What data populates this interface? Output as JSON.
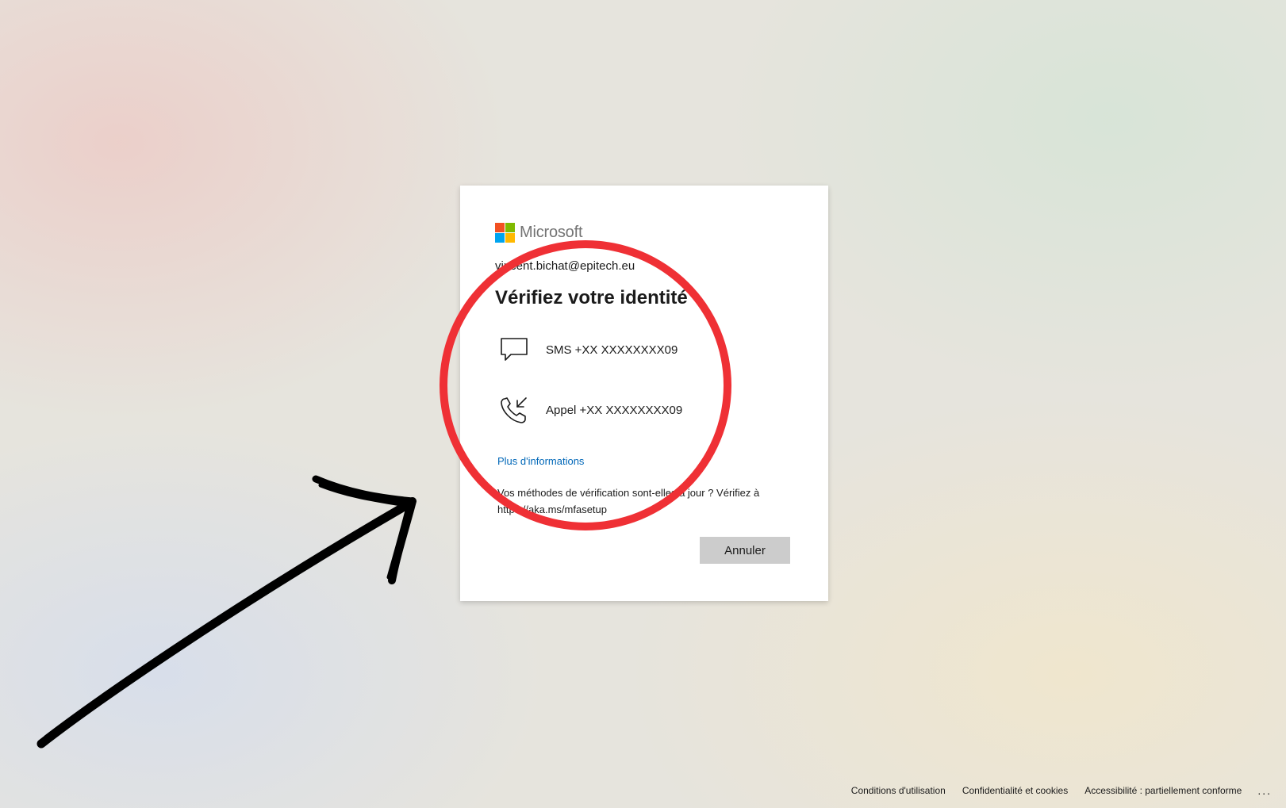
{
  "brand": {
    "name": "Microsoft",
    "logo_colors": [
      "#f25022",
      "#7fba00",
      "#00a4ef",
      "#ffb900"
    ]
  },
  "account": {
    "email": "vincent.bichat@epitech.eu"
  },
  "page_title": "Vérifiez votre identité",
  "options": [
    {
      "icon": "chat-bubble-icon",
      "label": "SMS +XX XXXXXXXX09"
    },
    {
      "icon": "phone-incoming-icon",
      "label": "Appel +XX XXXXXXXX09"
    }
  ],
  "more_info_link": "Plus d'informations",
  "note": "Vos méthodes de vérification sont-elles à jour ? Vérifiez à https://aka.ms/mfasetup",
  "cancel_label": "Annuler",
  "footer": {
    "terms": "Conditions d'utilisation",
    "privacy": "Confidentialité et cookies",
    "accessibility": "Accessibilité : partiellement conforme",
    "more": "..."
  },
  "colors": {
    "link": "#0067b8",
    "annotation_circle": "#ef3035",
    "annotation_arrow": "#000000",
    "cancel_button": "#cccccc"
  }
}
